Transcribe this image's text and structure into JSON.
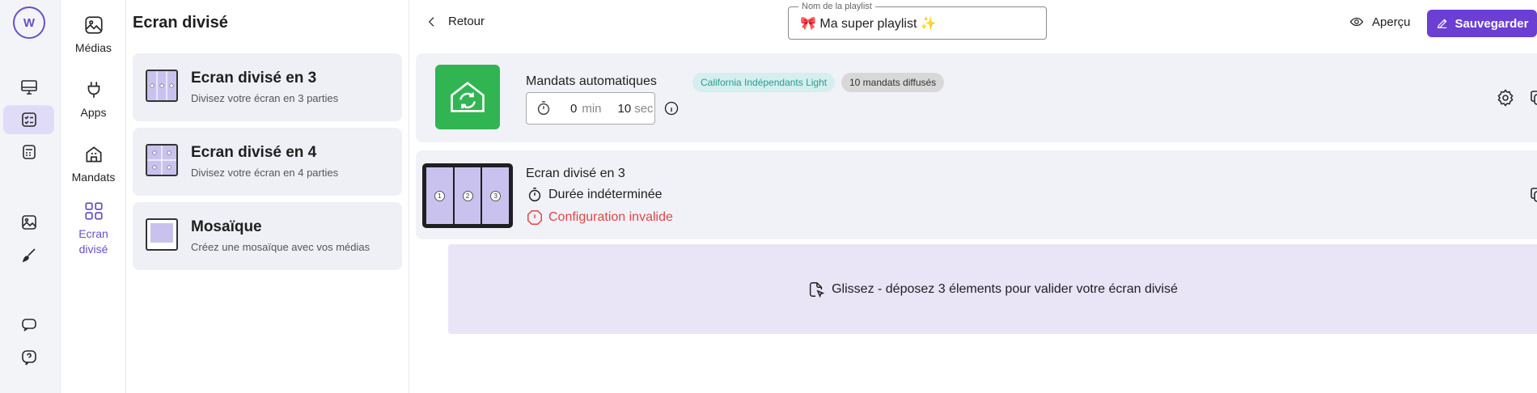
{
  "rail": {
    "logo_text": "W",
    "items": [
      "screen-icon",
      "playlist-icon",
      "schedule-icon",
      "image-icon",
      "brush-icon",
      "chat-icon",
      "help-icon"
    ],
    "active": "playlist-icon"
  },
  "categories": [
    {
      "label": "Médias",
      "icon": "image-icon"
    },
    {
      "label": "Apps",
      "icon": "plug-icon"
    },
    {
      "label": "Mandats",
      "icon": "house-icon"
    },
    {
      "label": "Ecran divisé",
      "icon": "split-icon",
      "active": true
    }
  ],
  "panel": {
    "title": "Ecran divisé",
    "cards": [
      {
        "title": "Ecran divisé en 3",
        "subtitle": "Divisez votre écran en 3 parties"
      },
      {
        "title": "Ecran divisé en 4",
        "subtitle": "Divisez votre écran en 4 parties"
      },
      {
        "title": "Mosaïque",
        "subtitle": "Créez une mosaïque avec vos médias"
      }
    ]
  },
  "header": {
    "back_label": "Retour",
    "playlist_name_label": "Nom de la playlist",
    "playlist_name_value": "🎀 Ma super playlist ✨",
    "preview_label": "Aperçu",
    "save_label": "Sauvegarder"
  },
  "items": [
    {
      "title": "Mandats automatiques",
      "badge_agency": "California Indépendants Light",
      "badge_count": "10 mandats diffusés",
      "duration_min": "0",
      "duration_min_unit": "min",
      "duration_sec": "10",
      "duration_sec_unit": "sec",
      "colors": {
        "tile": "#31b553"
      }
    },
    {
      "title": "Ecran divisé en 3",
      "segments": [
        "1",
        "2",
        "3"
      ],
      "duration": "Durée indéterminée",
      "error": "Configuration invalide",
      "colors": {
        "error": "#e04646"
      }
    }
  ],
  "dropzone": {
    "text": "Glissez - déposez 3 élements pour valider votre écran divisé"
  },
  "colors": {
    "accent": "#6b3fd4",
    "active_bg": "#e0dcf7",
    "dropzone_bg": "#e9e5f6"
  }
}
